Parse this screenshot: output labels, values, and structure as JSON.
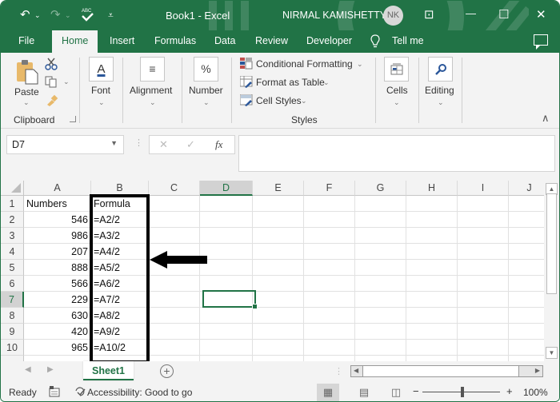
{
  "titlebar": {
    "title": "Book1  -  Excel",
    "user_name": "NIRMAL KAMISHETTY",
    "user_initials": "NK",
    "undo_icon": "↶",
    "redo_icon": "↷",
    "qat_chevron": "⌄",
    "customize_qat_icon": "⩡",
    "restore_ribbon_icon": "⊡",
    "minimize_icon": "—",
    "maximize_icon": "☐",
    "close_icon": "✕"
  },
  "tabs": [
    {
      "label": "File"
    },
    {
      "label": "Home",
      "active": true
    },
    {
      "label": "Insert"
    },
    {
      "label": "Formulas"
    },
    {
      "label": "Data"
    },
    {
      "label": "Review"
    },
    {
      "label": "Developer"
    },
    {
      "label": "Tell me"
    }
  ],
  "ribbon": {
    "clipboard": {
      "paste": "Paste",
      "group": "Clipboard"
    },
    "font": {
      "label": "Font",
      "icon": "A"
    },
    "alignment": {
      "label": "Alignment",
      "icon": "≡"
    },
    "number": {
      "label": "Number",
      "icon": "%"
    },
    "styles": {
      "conditional_formatting": "Conditional Formatting",
      "format_as_table": "Format as Table",
      "cell_styles": "Cell Styles",
      "group": "Styles"
    },
    "cells": {
      "label": "Cells"
    },
    "editing": {
      "label": "Editing",
      "icon": "⚲"
    },
    "collapse_icon": "∧",
    "chevron": "⌄"
  },
  "formula_bar": {
    "name_box": "D7",
    "cancel_icon": "✕",
    "enter_icon": "✓",
    "fx_label": "fx",
    "formula": ""
  },
  "grid": {
    "columns": [
      "A",
      "B",
      "C",
      "D",
      "E",
      "F",
      "G",
      "H",
      "I",
      "J"
    ],
    "selected_column": "D",
    "selected_row": 7,
    "active_cell": "D7",
    "rows": [
      {
        "num": "1",
        "A": "Numbers",
        "B": "Formula"
      },
      {
        "num": "2",
        "A": "546",
        "B": "=A2/2"
      },
      {
        "num": "3",
        "A": "986",
        "B": "=A3/2"
      },
      {
        "num": "4",
        "A": "207",
        "B": "=A4/2"
      },
      {
        "num": "5",
        "A": "888",
        "B": "=A5/2"
      },
      {
        "num": "6",
        "A": "566",
        "B": "=A6/2"
      },
      {
        "num": "7",
        "A": "229",
        "B": "=A7/2"
      },
      {
        "num": "8",
        "A": "630",
        "B": "=A8/2"
      },
      {
        "num": "9",
        "A": "420",
        "B": "=A9/2"
      },
      {
        "num": "10",
        "A": "965",
        "B": "=A10/2"
      }
    ],
    "annotation": {
      "highlight": "Column B (Formula) outlined",
      "arrow": "pointing left at column B"
    }
  },
  "sheets": {
    "tabs": [
      "Sheet1"
    ],
    "active": "Sheet1",
    "add_icon": "+",
    "prev_icon": "◀",
    "next_icon": "▶"
  },
  "statusbar": {
    "ready": "Ready",
    "accessibility": "Accessibility: Good to go",
    "zoom_minus": "−",
    "zoom_plus": "+",
    "zoom_level": "100%"
  }
}
